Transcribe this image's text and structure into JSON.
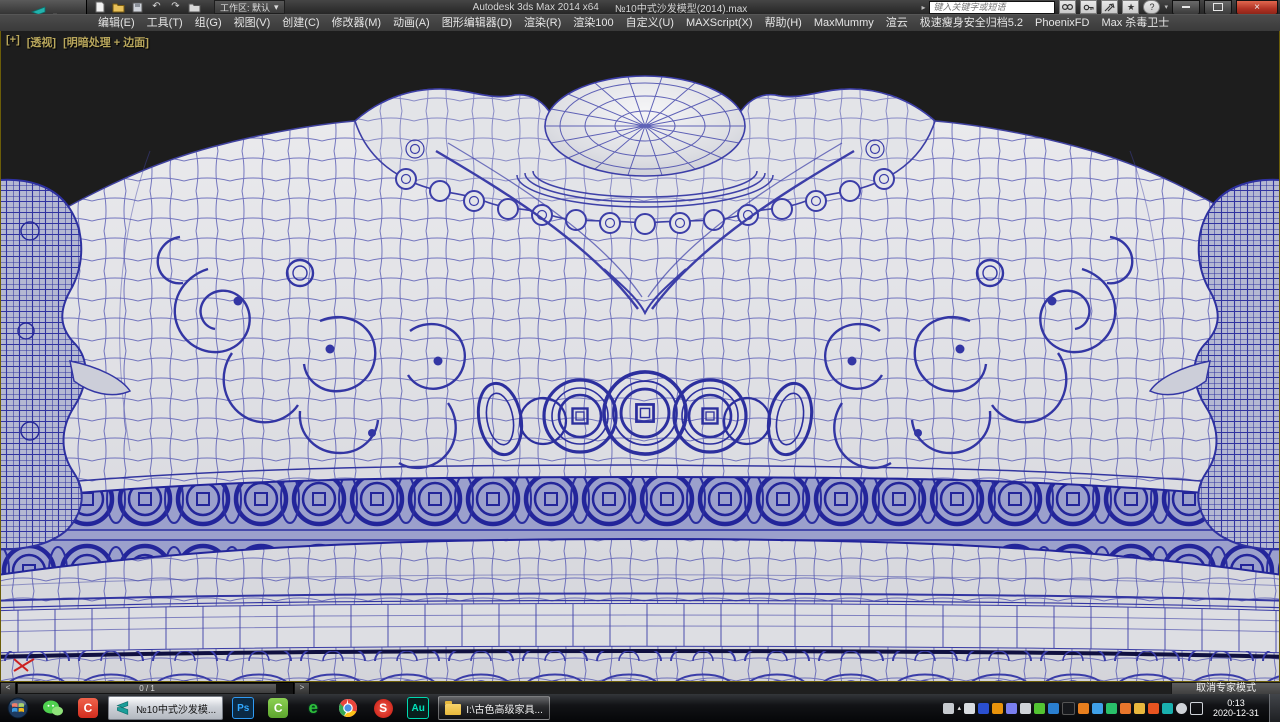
{
  "window": {
    "app_button_label": "3ds Max",
    "workspace": "工作区: 默认",
    "title_app": "Autodesk 3ds Max  2014 x64",
    "title_doc": "№10中式沙发模型(2014).max",
    "search_placeholder": "键入关键字或短语"
  },
  "menu": {
    "items": [
      "编辑(E)",
      "工具(T)",
      "组(G)",
      "视图(V)",
      "创建(C)",
      "修改器(M)",
      "动画(A)",
      "图形编辑器(D)",
      "渲染(R)",
      "渲染100",
      "自定义(U)",
      "MAXScript(X)",
      "帮助(H)",
      "MaxMummy",
      "渲云",
      "极速瘦身安全归档5.2",
      "PhoenixFD",
      "Max 杀毒卫士"
    ]
  },
  "viewport": {
    "label_plus": "[+]",
    "label_view": "[透视]",
    "label_shading": "[明暗处理 + 边面]"
  },
  "statusbar": {
    "prev": "<",
    "frames": "0 / 1",
    "next": ">",
    "expert_button": "取消专家模式"
  },
  "taskbar": {
    "task_max": "№10中式沙发模...",
    "task_folder": "I:\\古色高级家具...",
    "clock_time": "0:13",
    "clock_date": "2020-12-31"
  },
  "icons": {
    "undo": "↶",
    "redo": "↷",
    "expand_arrow": "▸",
    "star": "★",
    "help": "?",
    "caret": "▾",
    "close": "×",
    "photoshop": "Ps",
    "audition": "Au",
    "camtasia_red": "C",
    "camtasia_green": "C",
    "browser_e": "e",
    "s_app": "S"
  },
  "colors": {
    "wireframe_blue": "#3a3dab",
    "surface_gray": "#d9dade",
    "coin_band": "#9ba0cc",
    "viewport_bg": "#1d1d1d",
    "active_border_yellow": "#6b5d08",
    "close_red": "#b03224"
  }
}
